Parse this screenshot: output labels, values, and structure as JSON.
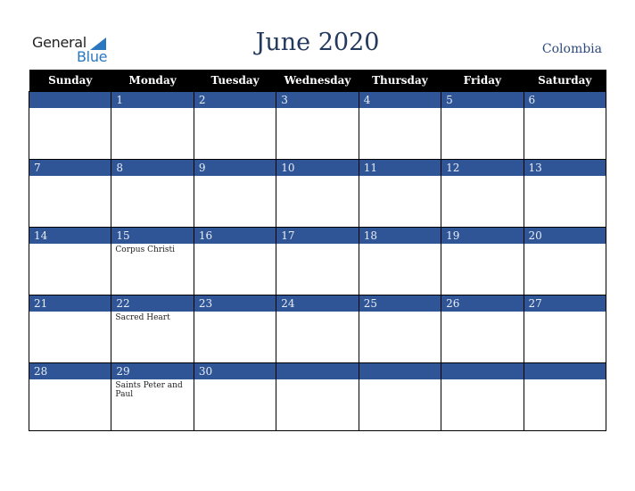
{
  "logo": {
    "line1": "General",
    "line2": "Blue"
  },
  "title": "June 2020",
  "country": "Colombia",
  "weekdays": [
    "Sunday",
    "Monday",
    "Tuesday",
    "Wednesday",
    "Thursday",
    "Friday",
    "Saturday"
  ],
  "colors": {
    "header_bg": "#000000",
    "day_strip": "#2f5597",
    "title": "#23395d",
    "logo_blue": "#2a77c0"
  },
  "weeks": [
    [
      {
        "day": ""
      },
      {
        "day": "1"
      },
      {
        "day": "2"
      },
      {
        "day": "3"
      },
      {
        "day": "4"
      },
      {
        "day": "5"
      },
      {
        "day": "6"
      }
    ],
    [
      {
        "day": "7"
      },
      {
        "day": "8"
      },
      {
        "day": "9"
      },
      {
        "day": "10"
      },
      {
        "day": "11"
      },
      {
        "day": "12"
      },
      {
        "day": "13"
      }
    ],
    [
      {
        "day": "14"
      },
      {
        "day": "15",
        "holiday": "Corpus Christi"
      },
      {
        "day": "16"
      },
      {
        "day": "17"
      },
      {
        "day": "18"
      },
      {
        "day": "19"
      },
      {
        "day": "20"
      }
    ],
    [
      {
        "day": "21"
      },
      {
        "day": "22",
        "holiday": "Sacred Heart"
      },
      {
        "day": "23"
      },
      {
        "day": "24"
      },
      {
        "day": "25"
      },
      {
        "day": "26"
      },
      {
        "day": "27"
      }
    ],
    [
      {
        "day": "28"
      },
      {
        "day": "29",
        "holiday": "Saints Peter and Paul"
      },
      {
        "day": "30"
      },
      {
        "day": ""
      },
      {
        "day": ""
      },
      {
        "day": ""
      },
      {
        "day": ""
      }
    ]
  ]
}
